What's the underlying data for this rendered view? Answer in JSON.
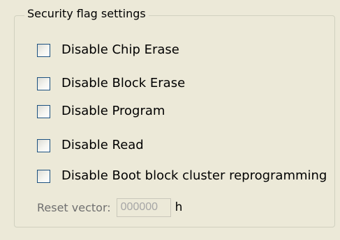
{
  "security_flags": {
    "title": "Security flag settings",
    "options": [
      {
        "label": "Disable Chip Erase",
        "checked": false
      },
      {
        "label": "Disable Block Erase",
        "checked": false
      },
      {
        "label": "Disable Program",
        "checked": false
      },
      {
        "label": "Disable Read",
        "checked": false
      },
      {
        "label": "Disable Boot block cluster reprogramming",
        "checked": false
      }
    ],
    "reset_vector": {
      "label": "Reset vector:",
      "value": "000000",
      "unit": "h",
      "enabled": false
    }
  },
  "colors": {
    "background": "#ece9d8",
    "checkbox_border": "#1c5180",
    "group_border": "#d0d0bf",
    "disabled_text": "#a6a6a6"
  }
}
